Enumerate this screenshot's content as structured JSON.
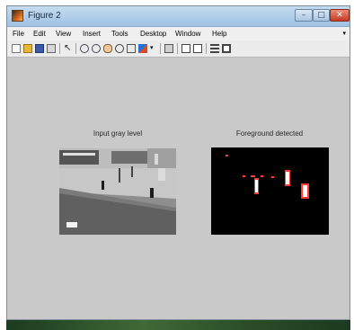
{
  "window": {
    "title": "Figure 2",
    "controls": [
      "minimize",
      "maximize",
      "close"
    ]
  },
  "menubar": {
    "items": [
      "File",
      "Edit",
      "View",
      "Insert",
      "Tools",
      "Desktop",
      "Window",
      "Help"
    ],
    "overflow_arrow": "▾"
  },
  "toolbar": {
    "icons": [
      "new-figure-icon",
      "open-file-icon",
      "save-icon",
      "print-icon",
      "edit-plot-arrow-icon",
      "zoom-in-icon",
      "zoom-out-icon",
      "pan-icon",
      "rotate-3d-icon",
      "data-cursor-icon",
      "brush-icon",
      "link-plot-icon",
      "insert-colorbar-icon",
      "insert-legend-icon",
      "hide-plot-tools-icon",
      "show-plot-tools-icon"
    ]
  },
  "figure": {
    "panels": [
      {
        "title": "Input gray level",
        "content": "grayscale street scene with pedestrians"
      },
      {
        "title": "Foreground detected",
        "content": "binary foreground mask on black background"
      }
    ]
  },
  "colors": {
    "figure_background": "#c9c9c9",
    "titlebar": "#a9c8e6",
    "mask_highlight": "#ff3a30"
  }
}
